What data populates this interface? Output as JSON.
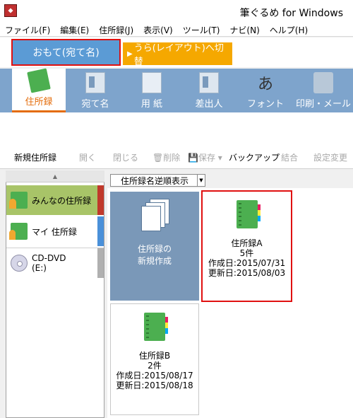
{
  "window": {
    "title": "筆ぐるめ for Windows"
  },
  "menu": [
    "ファイル(F)",
    "編集(E)",
    "住所録(J)",
    "表示(V)",
    "ツール(T)",
    "ナビ(N)",
    "ヘルプ(H)"
  ],
  "mode": {
    "front": "おもて(宛て名)",
    "back": "うら(レイアウト)へ切替"
  },
  "ribbon": {
    "address": "住所録",
    "recipient": "宛て名",
    "paper": "用 紙",
    "sender": "差出人",
    "font": "フォント",
    "print": "印刷・メール",
    "font_glyph": "あ"
  },
  "toolbar": {
    "new": "新規住所録",
    "open": "開く",
    "close": "閉じる",
    "delete": "削除",
    "save": "保存",
    "backup": "バックアップ",
    "merge": "結合",
    "settings": "設定変更"
  },
  "sidebar": {
    "items": [
      {
        "label": "みんなの住所録",
        "marker": "#c0392b"
      },
      {
        "label": "マイ 住所録",
        "marker": "#4a90d9"
      },
      {
        "label": "CD-DVD",
        "sub": "(E:)"
      }
    ]
  },
  "sort": {
    "selected": "住所録名逆順表示"
  },
  "new_tile": {
    "line1": "住所録の",
    "line2": "新規作成"
  },
  "books": [
    {
      "name": "住所録A",
      "count": "5件",
      "created": "作成日:2015/07/31",
      "updated": "更新日:2015/08/03"
    },
    {
      "name": "住所録B",
      "count": "2件",
      "created": "作成日:2015/08/17",
      "updated": "更新日:2015/08/18"
    }
  ],
  "colors": {
    "accent": "#e46c0a",
    "highlight": "#e01010",
    "ribbon": "#7ea4cc",
    "front_tab": "#5b9bd5",
    "back_tab": "#f5a800"
  }
}
